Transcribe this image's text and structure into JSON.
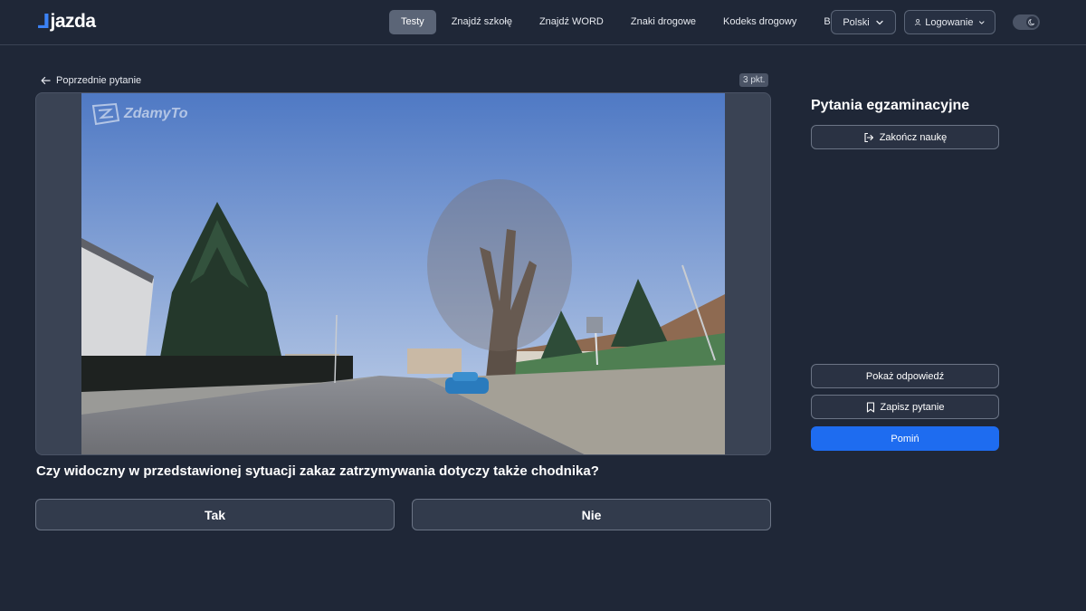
{
  "header": {
    "logo": "jazda",
    "nav": [
      {
        "label": "Testy",
        "active": true
      },
      {
        "label": "Znajdź szkołę",
        "active": false
      },
      {
        "label": "Znajdź WORD",
        "active": false
      },
      {
        "label": "Znaki drogowe",
        "active": false
      },
      {
        "label": "Kodeks drogowy",
        "active": false
      },
      {
        "label": "Blog",
        "active": false
      }
    ],
    "language": "Polski",
    "login": "Logowanie"
  },
  "main": {
    "prev_label": "Poprzednie pytanie",
    "points": "3 pkt.",
    "watermark": "ZdamyTo",
    "question": "Czy widoczny w przedstawionej sytuacji zakaz zatrzymywania dotyczy także chodnika?",
    "answers": [
      "Tak",
      "Nie"
    ]
  },
  "sidebar": {
    "title": "Pytania egzaminacyjne",
    "finish_label": "Zakończ naukę",
    "show_label": "Pokaż odpowiedź",
    "save_label": "Zapisz pytanie",
    "skip_label": "Pomiń"
  },
  "colors": {
    "background": "#1f2737",
    "accent": "#1e6cf0",
    "logo_mark": "#3b82f6"
  }
}
